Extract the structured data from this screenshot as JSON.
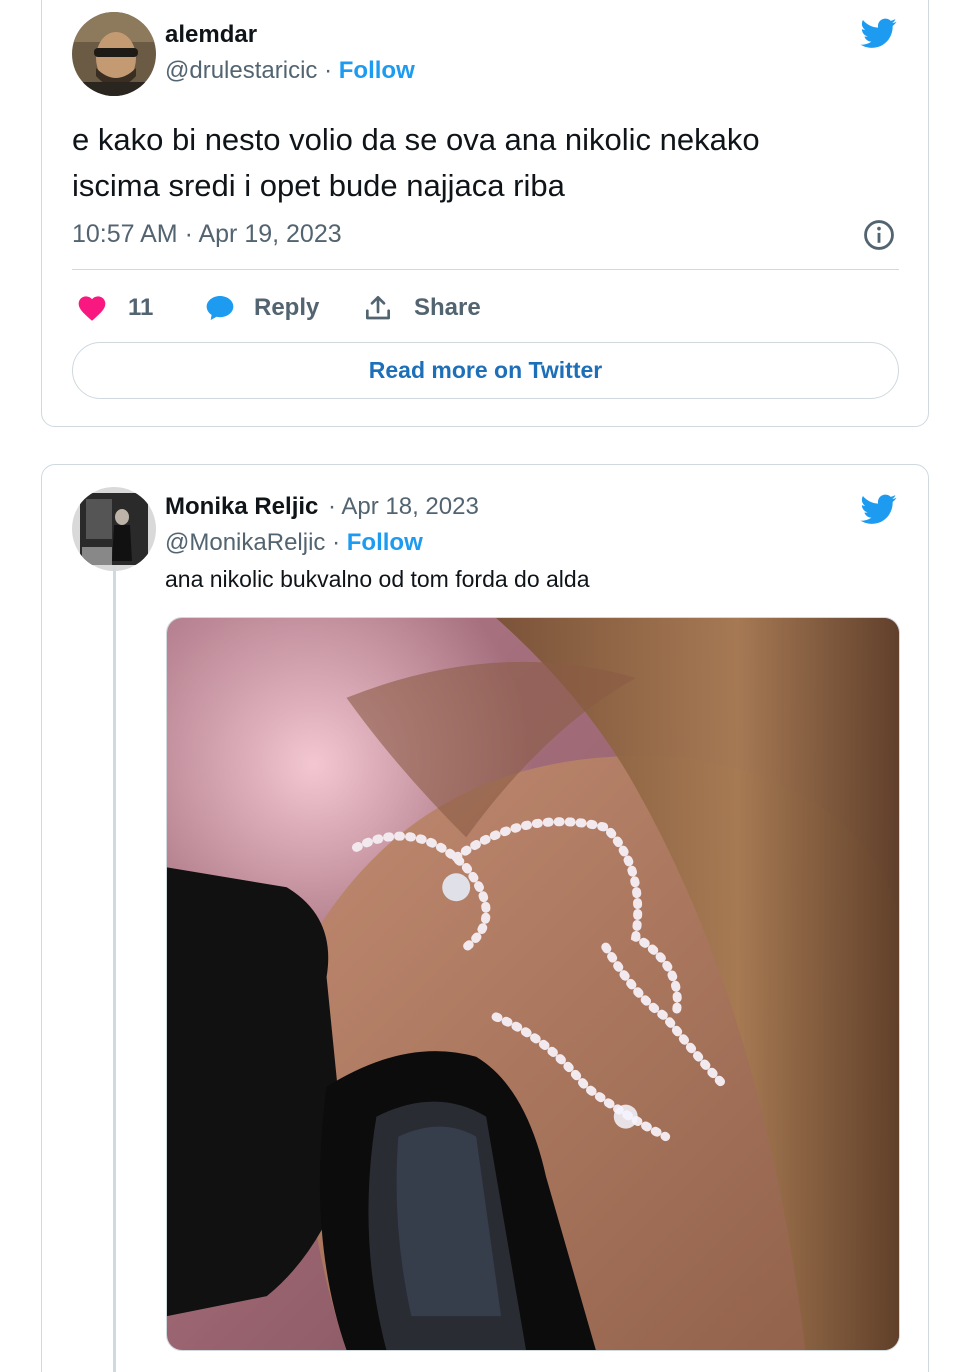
{
  "tweet1": {
    "name": "alemdar",
    "handle": "@drulestaricic",
    "separator": "·",
    "follow": "Follow",
    "text_line1": "e kako bi nesto volio da se ova ana nikolic nekako",
    "text_line2": "iscima sredi i opet bude najjaca riba",
    "timestamp": "10:57 AM · Apr 19, 2023",
    "likes": "11",
    "reply": "Reply",
    "share": "Share",
    "read_more": "Read more on Twitter"
  },
  "tweet2": {
    "name": "Monika Reljic",
    "date": "· Apr 18, 2023",
    "handle": "@MonikaReljic",
    "separator": "·",
    "follow": "Follow",
    "text": "ana nikolic bukvalno od tom forda do alda"
  },
  "colors": {
    "twitter_blue": "#1d9bf0",
    "like_pink": "#f91880",
    "muted": "#536471",
    "border": "#cfd9de"
  },
  "icons": [
    "twitter-bird-icon",
    "info-icon",
    "heart-icon",
    "reply-bubble-icon",
    "share-icon"
  ]
}
